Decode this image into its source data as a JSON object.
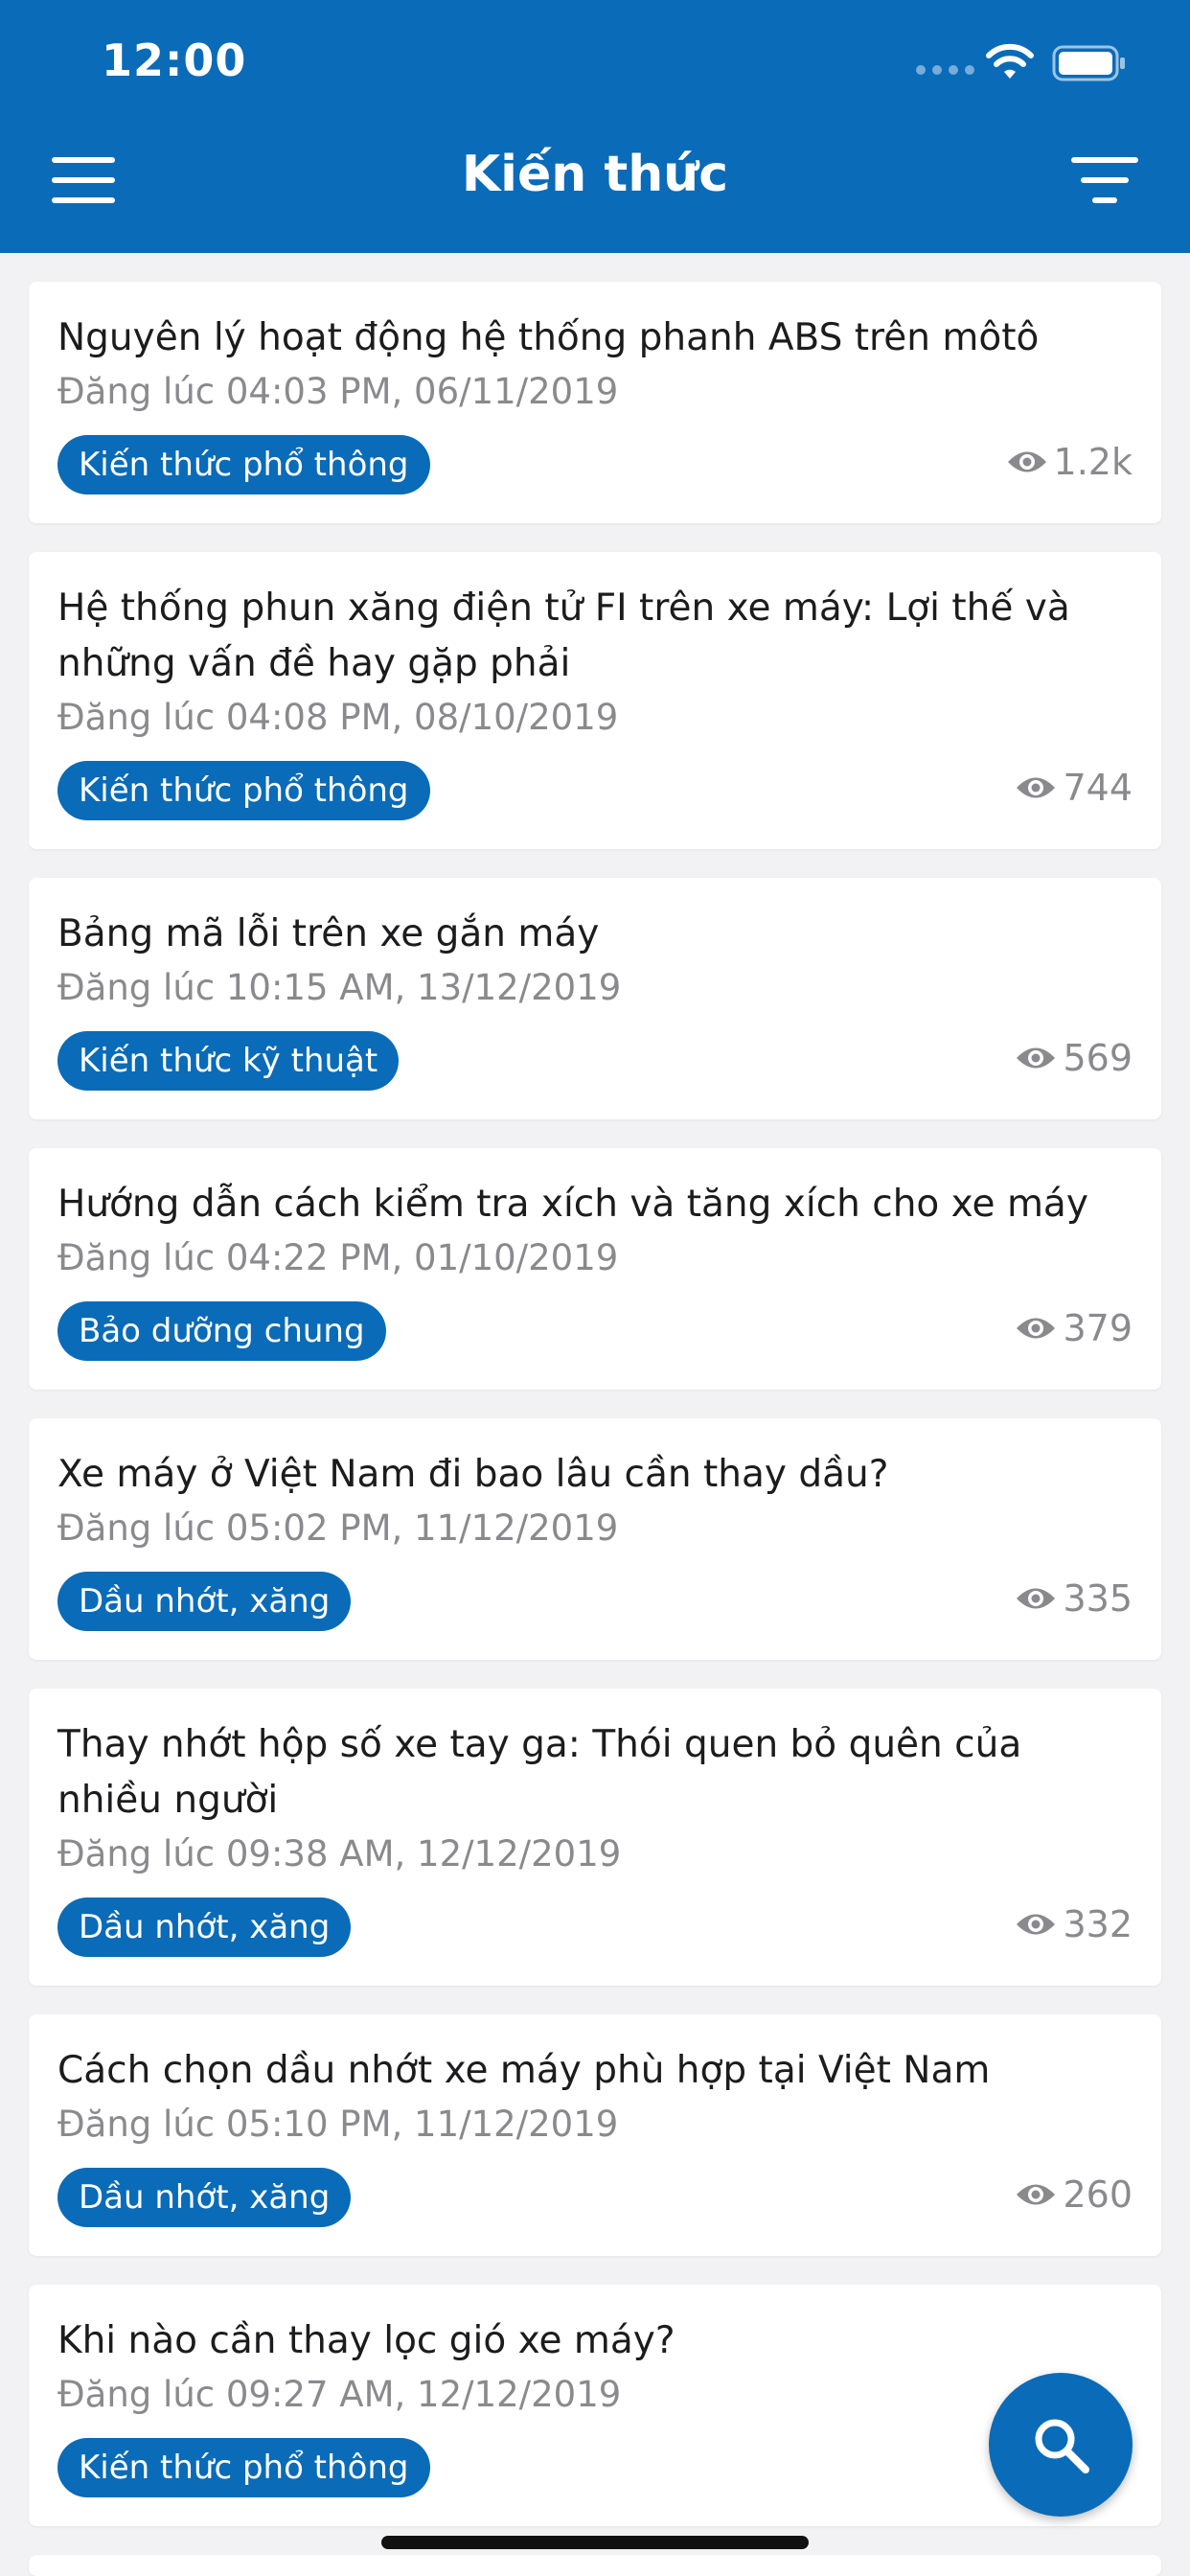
{
  "status_bar": {
    "time": "12:00"
  },
  "header": {
    "title": "Kiến thức",
    "menu_icon": "hamburger-menu-icon",
    "filter_icon": "filter-icon"
  },
  "articles": [
    {
      "title": "Nguyên lý hoạt động hệ thống phanh ABS trên môtô",
      "date": "Đăng lúc 04:03 PM, 06/11/2019",
      "tag": "Kiến thức phổ thông",
      "views": "1.2k"
    },
    {
      "title": "Hệ thống phun xăng điện tử FI trên xe máy: Lợi thế và những vấn đề hay gặp phải",
      "date": "Đăng lúc 04:08 PM, 08/10/2019",
      "tag": "Kiến thức phổ thông",
      "views": "744"
    },
    {
      "title": "Bảng mã lỗi trên xe gắn máy",
      "date": "Đăng lúc 10:15 AM, 13/12/2019",
      "tag": "Kiến thức kỹ thuật",
      "views": "569"
    },
    {
      "title": "Hướng dẫn cách kiểm tra xích và tăng xích cho xe máy",
      "date": "Đăng lúc 04:22 PM, 01/10/2019",
      "tag": "Bảo dưỡng chung",
      "views": "379"
    },
    {
      "title": "Xe máy ở Việt Nam đi bao lâu cần thay dầu?",
      "date": "Đăng lúc 05:02 PM, 11/12/2019",
      "tag": "Dầu nhớt, xăng",
      "views": "335"
    },
    {
      "title": "Thay nhớt hộp số xe tay ga: Thói quen bỏ quên của nhiều người",
      "date": "Đăng lúc 09:38 AM, 12/12/2019",
      "tag": "Dầu nhớt, xăng",
      "views": "332"
    },
    {
      "title": "Cách chọn dầu nhớt xe máy phù hợp tại Việt Nam",
      "date": "Đăng lúc 05:10 PM, 11/12/2019",
      "tag": "Dầu nhớt, xăng",
      "views": "260"
    },
    {
      "title": "Khi nào cần thay lọc gió xe máy?",
      "date": "Đăng lúc 09:27 AM, 12/12/2019",
      "tag": "Kiến thức phổ thông",
      "views": ""
    }
  ],
  "fab": {
    "icon": "search-icon"
  },
  "colors": {
    "brand": "#0a6bb8",
    "background": "#f2f2f4",
    "card": "#ffffff",
    "muted_text": "#8a8a8e"
  }
}
